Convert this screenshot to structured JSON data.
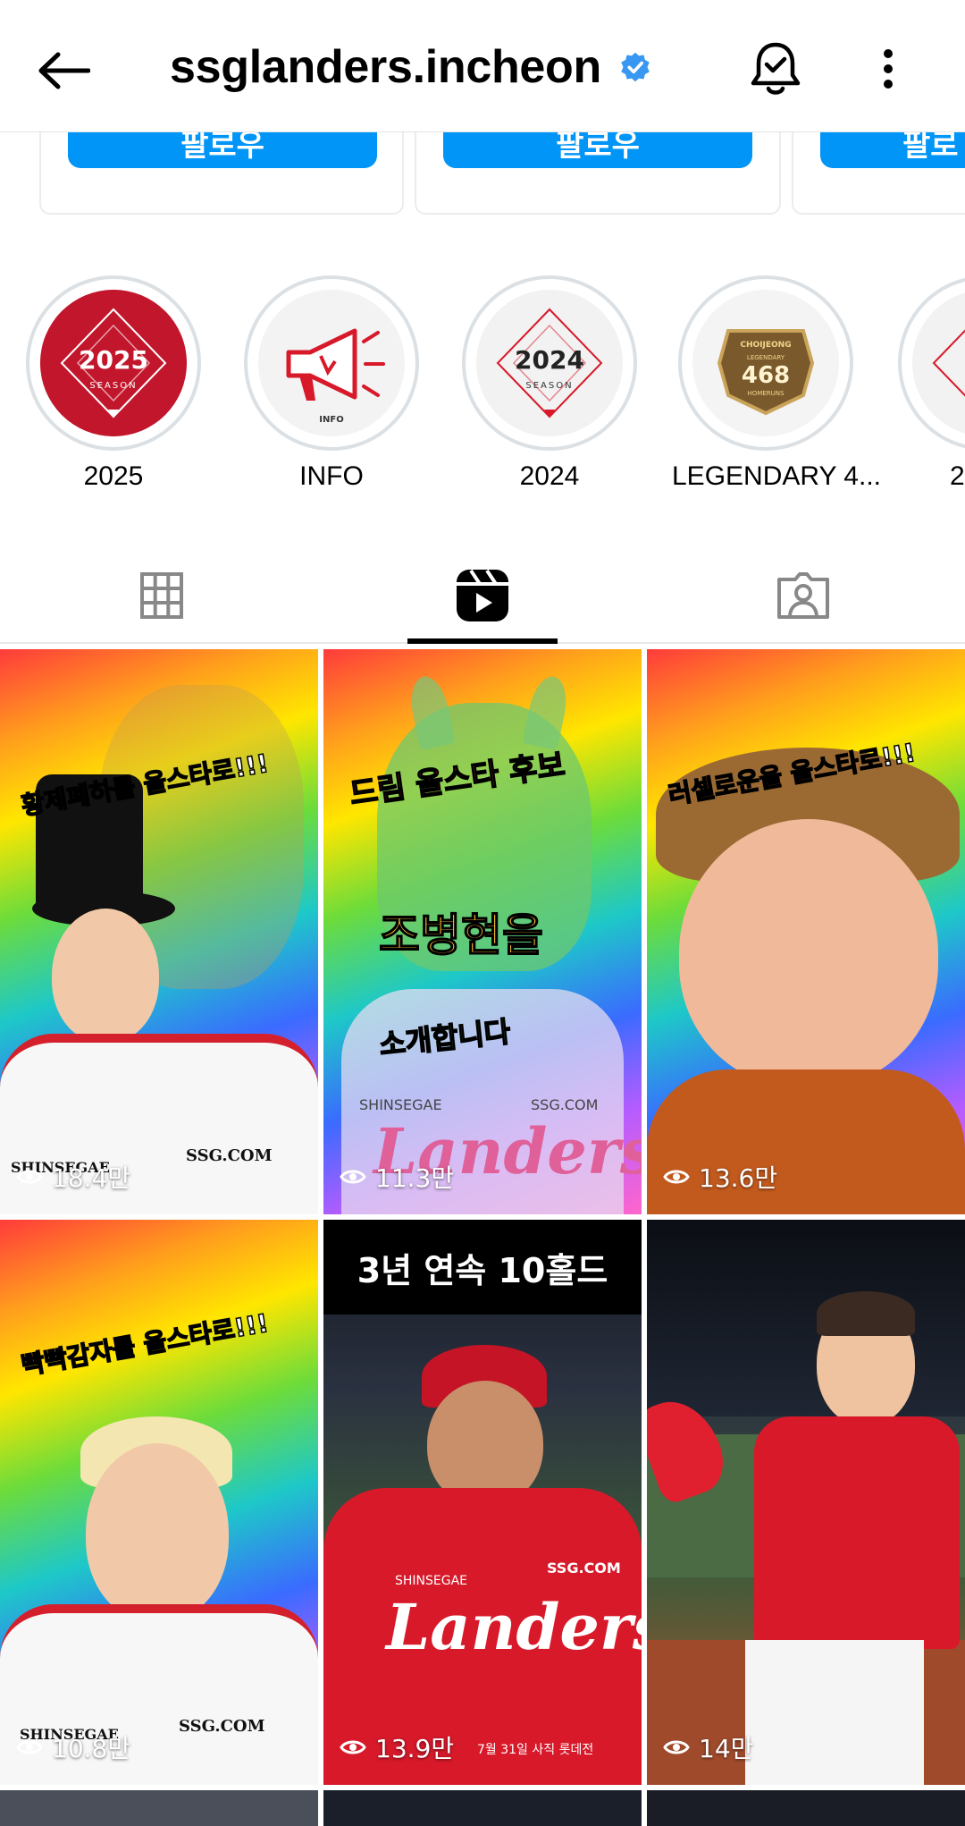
{
  "header": {
    "username": "ssglanders.incheon"
  },
  "suggested": {
    "follow_label": "팔로우",
    "follow_label_cut": "팔로"
  },
  "highlights": [
    {
      "label": "2025",
      "inner_text": "2025",
      "sub_text": "SEASON"
    },
    {
      "label": "INFO",
      "sub_text": "INFO"
    },
    {
      "label": "2024",
      "inner_text": "2024",
      "sub_text": "SEASON"
    },
    {
      "label": "LEGENDARY 4...",
      "inner_text": "468",
      "top_text": "CHOIJEONG",
      "mid_text": "LEGENDARY",
      "bottom_text": "HOMERUNS"
    },
    {
      "label": "2"
    }
  ],
  "tabs": [
    {
      "name": "grid-tab",
      "icon": "grid-icon",
      "active": false
    },
    {
      "name": "reels-tab",
      "icon": "reels-icon",
      "active": true
    },
    {
      "name": "tagged-tab",
      "icon": "tagged-person-icon",
      "active": false
    }
  ],
  "reels": [
    {
      "views": "18.4만",
      "overlay": "황제폐하를 올스타로!!!",
      "jersey_sponsor": "SSG.COM",
      "brand": "SHINSEGAE"
    },
    {
      "views": "11.3만",
      "overlay_top": "드림 올스타 후보",
      "overlay_mid": "조병현을",
      "overlay_bottom": "소개합니다",
      "brand_left": "SHINSEGAE",
      "brand_right": "SSG.COM",
      "logo": "Landers"
    },
    {
      "views": "13.6만",
      "overlay": "러셀로운을 올스타로!!!"
    },
    {
      "views": "10.8만",
      "overlay": "빡빡감자를 올스타로!!!",
      "jersey_sponsor": "SSG.COM",
      "brand": "SHINSEGAE"
    },
    {
      "views": "13.9만",
      "banner": "3년 연속 10홀드",
      "logo": "Landers",
      "jersey_sponsor": "SSG.COM",
      "brand": "SHINSEGAE",
      "caption": "7월 31일 사직 롯데전"
    },
    {
      "views": "14만"
    }
  ],
  "colors": {
    "follow_blue": "#0095f6",
    "verified_blue": "#3897f0",
    "landers_red": "#d7192a"
  }
}
